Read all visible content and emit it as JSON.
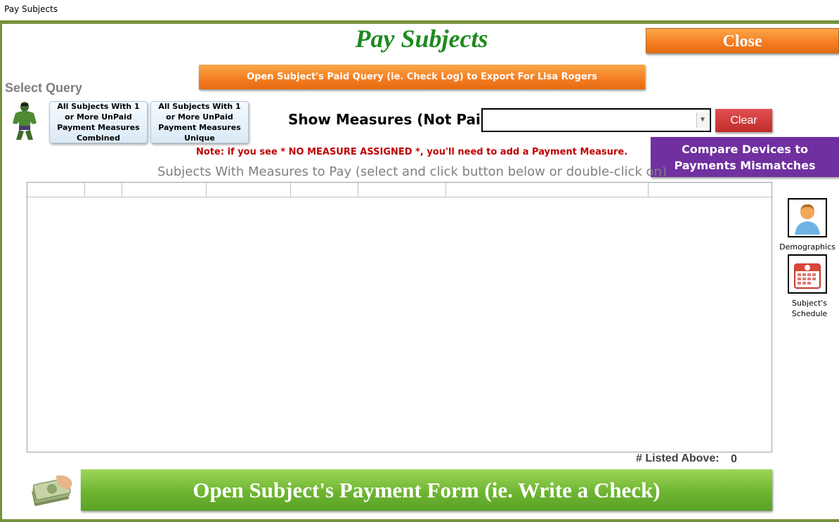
{
  "window": {
    "title": "Pay Subjects"
  },
  "header": {
    "title": "Pay Subjects",
    "close_label": "Close",
    "export_label": "Open Subject's Paid Query (ie. Check Log) to Export For Lisa Rogers"
  },
  "query": {
    "section_label": "Select Query",
    "avatar_icon": "hulk-icon",
    "buttons": [
      "All Subjects With 1 or More UnPaid Payment Measures Combined",
      "All Subjects With 1 or More UnPaid Payment Measures Unique"
    ]
  },
  "measures": {
    "label": "Show Measures (Not Paid):",
    "selected_value": "",
    "clear_label": "Clear"
  },
  "compare_button_label": "Compare Devices to Payments Mismatches",
  "note": "Note: if you see * NO MEASURE ASSIGNED *, you'll need to add a Payment Measure.",
  "list": {
    "title": "Subjects With Measures to Pay (select and click button below or double-click on)",
    "columns": [
      "",
      "",
      "",
      "",
      "",
      "",
      "",
      ""
    ],
    "rows": []
  },
  "side": {
    "demographics_label": "Demographics",
    "schedule_label": "Subject's Schedule",
    "icons": [
      "person-icon",
      "calendar-icon"
    ]
  },
  "footer": {
    "listed_label": "# Listed Above:",
    "listed_count": "0",
    "pay_label": "Open Subject's Payment Form (ie. Write a Check)",
    "money_icon": "money-icon"
  },
  "colors": {
    "frame": "#76923c",
    "title_green": "#1f8a1f",
    "orange": "#f47c20",
    "purple": "#7030a0",
    "note_red": "#c00000",
    "pay_green": "#6eb531",
    "clear_red": "#c02b2b"
  }
}
